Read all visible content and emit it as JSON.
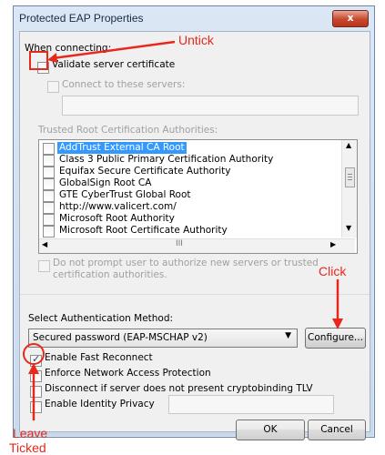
{
  "window": {
    "title": "Protected EAP Properties",
    "close_label": "x"
  },
  "section_connecting": "When connecting:",
  "validate_cert": {
    "label": "Validate server certificate",
    "checked": false
  },
  "connect_servers": {
    "label": "Connect to these servers:",
    "value": ""
  },
  "trusted_root_label": "Trusted Root Certification Authorities:",
  "ca_list": [
    {
      "label": "AddTrust External CA Root",
      "selected": true
    },
    {
      "label": "Class 3 Public Primary Certification Authority",
      "selected": false
    },
    {
      "label": "Equifax Secure Certificate Authority",
      "selected": false
    },
    {
      "label": "GlobalSign Root CA",
      "selected": false
    },
    {
      "label": "GTE CyberTrust Global Root",
      "selected": false
    },
    {
      "label": "http://www.valicert.com/",
      "selected": false
    },
    {
      "label": "Microsoft Root Authority",
      "selected": false
    },
    {
      "label": "Microsoft Root Certificate Authority",
      "selected": false
    }
  ],
  "hscroll_thumb": "III",
  "no_prompt": {
    "line1": "Do not prompt user to authorize new servers or trusted",
    "line2": "certification authorities."
  },
  "auth_method": {
    "label": "Select Authentication Method:",
    "selected": "Secured password (EAP-MSCHAP v2)"
  },
  "configure_label": "Configure...",
  "options": [
    {
      "label": "Enable Fast Reconnect",
      "checked": true
    },
    {
      "label": "Enforce Network Access Protection",
      "checked": false
    },
    {
      "label": "Disconnect if server does not present cryptobinding TLV",
      "checked": false
    },
    {
      "label": "Enable Identity Privacy",
      "checked": false
    }
  ],
  "identity_privacy_value": "",
  "ok_label": "OK",
  "cancel_label": "Cancel",
  "annotations": {
    "untick": "Untick",
    "click": "Click",
    "leave_ticked_1": "Leave",
    "leave_ticked_2": "Ticked"
  },
  "colors": {
    "annotation": "#e8281c",
    "selection": "#3399ff"
  }
}
